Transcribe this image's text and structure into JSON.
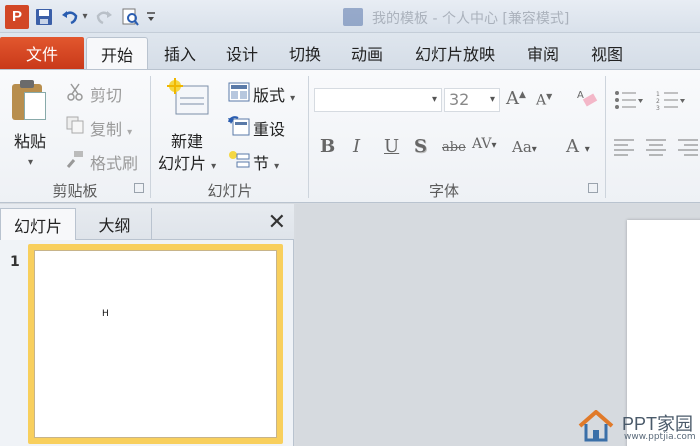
{
  "titlebar": {
    "app_logo": "P",
    "title": "我的模板 - 个人中心 [兼容模式]",
    "quick_access": [
      "save-icon",
      "undo-icon",
      "redo-icon",
      "print-preview-icon",
      "customize-icon"
    ]
  },
  "tabs": [
    {
      "label": "文件"
    },
    {
      "label": "开始"
    },
    {
      "label": "插入"
    },
    {
      "label": "设计"
    },
    {
      "label": "切换"
    },
    {
      "label": "动画"
    },
    {
      "label": "幻灯片放映"
    },
    {
      "label": "审阅"
    },
    {
      "label": "视图"
    }
  ],
  "ribbon": {
    "clipboard": {
      "paste": "粘贴",
      "cut": "剪切",
      "copy": "复制",
      "format_painter": "格式刷",
      "group_label": "剪贴板"
    },
    "slides": {
      "new_slide_line1": "新建",
      "new_slide_line2": "幻灯片",
      "layout": "版式",
      "reset": "重设",
      "section": "节",
      "group_label": "幻灯片"
    },
    "font": {
      "font_name": "",
      "font_size": "32",
      "group_label": "字体",
      "bold": "B",
      "italic": "I",
      "underline": "U",
      "shadow": "S",
      "strikethrough": "abe",
      "spacing": "AV",
      "case": "Aa",
      "color": "A"
    }
  },
  "slide_pane": {
    "tab_slides": "幻灯片",
    "tab_outline": "大纲",
    "close": "✕",
    "slide_number": "1",
    "thumb_text": "H"
  },
  "watermark": {
    "brand": "PPT家园",
    "url": "www.pptjia.com"
  },
  "colors": {
    "file_tab": "#d24726",
    "thumb_selection": "#f8cf5d"
  }
}
